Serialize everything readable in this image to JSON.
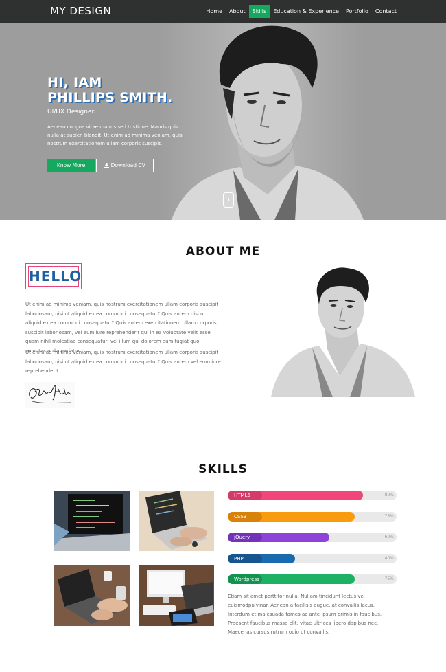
{
  "nav": {
    "brand": "MY DESIGN",
    "items": [
      {
        "label": "Home",
        "active": false
      },
      {
        "label": "About",
        "active": false
      },
      {
        "label": "Skills",
        "active": true
      },
      {
        "label": "Education & Experience",
        "active": false
      },
      {
        "label": "Portfolio",
        "active": false
      },
      {
        "label": "Contact",
        "active": false
      }
    ]
  },
  "hero": {
    "title_line1": "HI, IAM",
    "title_line2": "PHILLIPS SMITH.",
    "subtitle": "UI/UX Designer.",
    "text": "Aenean congue vitae mauris sed tristique. Mauris quis nulla at sapien blandit. Ut enim ad minima veniam, quis nostrum exercitationem ullam corporis suscipit.",
    "know_more_label": "Know More",
    "download_label": "Download CV",
    "download_icon": "download-icon"
  },
  "about": {
    "title": "ABOUT ME",
    "hello": "HELLO",
    "paragraph1": "Ut enim ad minima veniam, quis nostrum exercitationem ullam corporis suscipit laboriosam, nisi ut aliquid ex ea commodi consequatur? Quis autem nisi ut aliquid ex ea commodi consequatur? Quis autem exercitationem ullam corporis suscipit laboriosam, vel eum iure reprehenderit qui in ea voluptate velit esse quam nihil molestiae consequatur, vel illum qui dolorem eum fugiat quo voluptas nulla pariatur.",
    "paragraph2": "Ut enim ad minima veniam, quis nostrum exercitationem ullam corporis suscipit laboriosam, nisi ut aliquid ex ea commodi consequatur? Quis autem vel eum iure reprehenderit.",
    "signature_text": "P.Smith"
  },
  "skills": {
    "title": "SKILLS",
    "bars": [
      {
        "label": "HTML5",
        "percent": 80,
        "percent_label": "80%",
        "color": "#f0467a",
        "label_color": "#d63a69"
      },
      {
        "label": "CSS3",
        "percent": 75,
        "percent_label": "75%",
        "color": "#f89b0e",
        "label_color": "#d88208"
      },
      {
        "label": "jQuery",
        "percent": 60,
        "percent_label": "60%",
        "color": "#8e43d9",
        "label_color": "#7233b8"
      },
      {
        "label": "PHP",
        "percent": 40,
        "percent_label": "40%",
        "color": "#1a6ab0",
        "label_color": "#16558d"
      },
      {
        "label": "Wordpress",
        "percent": 75,
        "percent_label": "75%",
        "color": "#1db263",
        "label_color": "#129450"
      }
    ],
    "text": "Etiam sit amet porttitor nulla. Nullam tincidunt lectus vel euismodpulvinar. Aenean a facilisis augue, at convallis lacus. Interdum et malesuada fames ac ante ipsum primis in faucibus. Praesent faucibus massa elit, vitae ultrices libero dapibus nec. Maecenas cursus rutrum odio ut convallis."
  },
  "colors": {
    "accent_green": "#16a85f",
    "nav_bg": "#2f3030",
    "hero_bg": "#9d9d9d",
    "hello_border": "#e4457a",
    "hello_text": "#1f5fa0"
  }
}
